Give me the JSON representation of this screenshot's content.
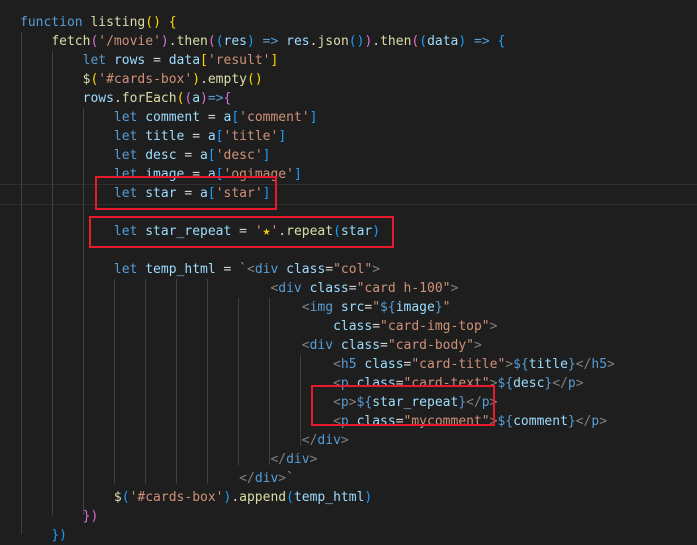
{
  "editor": {
    "lines": [
      [
        [
          "kw",
          "function"
        ],
        [
          "op",
          " "
        ],
        [
          "fn",
          "listing"
        ],
        [
          "b1",
          "()"
        ],
        [
          "op",
          " "
        ],
        [
          "b1",
          "{"
        ]
      ],
      [
        [
          "op",
          "    "
        ],
        [
          "fn",
          "fetch"
        ],
        [
          "b2",
          "("
        ],
        [
          "str",
          "'/movie'"
        ],
        [
          "b2",
          ")"
        ],
        [
          "op",
          "."
        ],
        [
          "fn",
          "then"
        ],
        [
          "b2",
          "("
        ],
        [
          "b3",
          "("
        ],
        [
          "var",
          "res"
        ],
        [
          "b3",
          ")"
        ],
        [
          "op",
          " "
        ],
        [
          "kw",
          "=>"
        ],
        [
          "op",
          " "
        ],
        [
          "var",
          "res"
        ],
        [
          "op",
          "."
        ],
        [
          "fn",
          "json"
        ],
        [
          "b3",
          "()"
        ],
        [
          "b2",
          ")"
        ],
        [
          "op",
          "."
        ],
        [
          "fn",
          "then"
        ],
        [
          "b2",
          "("
        ],
        [
          "b3",
          "("
        ],
        [
          "var",
          "data"
        ],
        [
          "b3",
          ")"
        ],
        [
          "op",
          " "
        ],
        [
          "kw",
          "=>"
        ],
        [
          "op",
          " "
        ],
        [
          "b3",
          "{"
        ]
      ],
      [
        [
          "op",
          "        "
        ],
        [
          "kw",
          "let"
        ],
        [
          "op",
          " "
        ],
        [
          "var",
          "rows"
        ],
        [
          "op",
          " = "
        ],
        [
          "var",
          "data"
        ],
        [
          "b1",
          "["
        ],
        [
          "str",
          "'result'"
        ],
        [
          "b1",
          "]"
        ]
      ],
      [
        [
          "op",
          "        "
        ],
        [
          "fn",
          "$"
        ],
        [
          "b1",
          "("
        ],
        [
          "str",
          "'#cards-box'"
        ],
        [
          "b1",
          ")"
        ],
        [
          "op",
          "."
        ],
        [
          "fn",
          "empty"
        ],
        [
          "b1",
          "()"
        ]
      ],
      [
        [
          "op",
          "        "
        ],
        [
          "var",
          "rows"
        ],
        [
          "op",
          "."
        ],
        [
          "fn",
          "forEach"
        ],
        [
          "b1",
          "("
        ],
        [
          "b2",
          "("
        ],
        [
          "var",
          "a"
        ],
        [
          "b2",
          ")"
        ],
        [
          "kw",
          "=>"
        ],
        [
          "b2",
          "{"
        ]
      ],
      [
        [
          "op",
          "            "
        ],
        [
          "kw",
          "let"
        ],
        [
          "op",
          " "
        ],
        [
          "var",
          "comment"
        ],
        [
          "op",
          " = "
        ],
        [
          "var",
          "a"
        ],
        [
          "b3",
          "["
        ],
        [
          "str",
          "'comment'"
        ],
        [
          "b3",
          "]"
        ]
      ],
      [
        [
          "op",
          "            "
        ],
        [
          "kw",
          "let"
        ],
        [
          "op",
          " "
        ],
        [
          "var",
          "title"
        ],
        [
          "op",
          " = "
        ],
        [
          "var",
          "a"
        ],
        [
          "b3",
          "["
        ],
        [
          "str",
          "'title'"
        ],
        [
          "b3",
          "]"
        ]
      ],
      [
        [
          "op",
          "            "
        ],
        [
          "kw",
          "let"
        ],
        [
          "op",
          " "
        ],
        [
          "var",
          "desc"
        ],
        [
          "op",
          " = "
        ],
        [
          "var",
          "a"
        ],
        [
          "b3",
          "["
        ],
        [
          "str",
          "'desc'"
        ],
        [
          "b3",
          "]"
        ]
      ],
      [
        [
          "op",
          "            "
        ],
        [
          "kw",
          "let"
        ],
        [
          "op",
          " "
        ],
        [
          "var",
          "image"
        ],
        [
          "op",
          " = "
        ],
        [
          "var",
          "a"
        ],
        [
          "b3",
          "["
        ],
        [
          "str",
          "'ogimage'"
        ],
        [
          "b3",
          "]"
        ]
      ],
      [
        [
          "op",
          "            "
        ],
        [
          "kw",
          "let"
        ],
        [
          "op",
          " "
        ],
        [
          "var",
          "star"
        ],
        [
          "op",
          " = "
        ],
        [
          "var",
          "a"
        ],
        [
          "b3",
          "["
        ],
        [
          "str",
          "'star'"
        ],
        [
          "b3",
          "]"
        ]
      ],
      [],
      [
        [
          "op",
          "            "
        ],
        [
          "kw",
          "let"
        ],
        [
          "op",
          " "
        ],
        [
          "var",
          "star_repeat"
        ],
        [
          "op",
          " = "
        ],
        [
          "str",
          "'"
        ],
        [
          "star",
          "★"
        ],
        [
          "str",
          "'"
        ],
        [
          "op",
          "."
        ],
        [
          "fn",
          "repeat"
        ],
        [
          "b3",
          "("
        ],
        [
          "var",
          "star"
        ],
        [
          "b3",
          ")"
        ]
      ],
      [],
      [
        [
          "op",
          "            "
        ],
        [
          "kw",
          "let"
        ],
        [
          "op",
          " "
        ],
        [
          "var",
          "temp_html"
        ],
        [
          "op",
          " = "
        ],
        [
          "str",
          "`"
        ],
        [
          "tag",
          "<"
        ],
        [
          "tn",
          "div"
        ],
        [
          "op",
          " "
        ],
        [
          "attr",
          "class"
        ],
        [
          "op",
          "="
        ],
        [
          "aval",
          "\"col\""
        ],
        [
          "tag",
          ">"
        ]
      ],
      [
        [
          "op",
          "                                "
        ],
        [
          "tag",
          "<"
        ],
        [
          "tn",
          "div"
        ],
        [
          "op",
          " "
        ],
        [
          "attr",
          "class"
        ],
        [
          "op",
          "="
        ],
        [
          "aval",
          "\"card h-100\""
        ],
        [
          "tag",
          ">"
        ]
      ],
      [
        [
          "op",
          "                                    "
        ],
        [
          "tag",
          "<"
        ],
        [
          "tn",
          "img"
        ],
        [
          "op",
          " "
        ],
        [
          "attr",
          "src"
        ],
        [
          "op",
          "="
        ],
        [
          "aval",
          "\""
        ],
        [
          "tmpl",
          "${"
        ],
        [
          "var",
          "image"
        ],
        [
          "tmpl",
          "}"
        ],
        [
          "aval",
          "\""
        ]
      ],
      [
        [
          "op",
          "                                        "
        ],
        [
          "attr",
          "class"
        ],
        [
          "op",
          "="
        ],
        [
          "aval",
          "\"card-img-top\""
        ],
        [
          "tag",
          ">"
        ]
      ],
      [
        [
          "op",
          "                                    "
        ],
        [
          "tag",
          "<"
        ],
        [
          "tn",
          "div"
        ],
        [
          "op",
          " "
        ],
        [
          "attr",
          "class"
        ],
        [
          "op",
          "="
        ],
        [
          "aval",
          "\"card-body\""
        ],
        [
          "tag",
          ">"
        ]
      ],
      [
        [
          "op",
          "                                        "
        ],
        [
          "tag",
          "<"
        ],
        [
          "tn",
          "h5"
        ],
        [
          "op",
          " "
        ],
        [
          "attr",
          "class"
        ],
        [
          "op",
          "="
        ],
        [
          "aval",
          "\"card-title\""
        ],
        [
          "tag",
          ">"
        ],
        [
          "tmpl",
          "${"
        ],
        [
          "var",
          "title"
        ],
        [
          "tmpl",
          "}"
        ],
        [
          "tag",
          "</"
        ],
        [
          "tn",
          "h5"
        ],
        [
          "tag",
          ">"
        ]
      ],
      [
        [
          "op",
          "                                        "
        ],
        [
          "tag",
          "<"
        ],
        [
          "tn",
          "p"
        ],
        [
          "op",
          " "
        ],
        [
          "attr",
          "class"
        ],
        [
          "op",
          "="
        ],
        [
          "aval",
          "\"card-text\""
        ],
        [
          "tag",
          ">"
        ],
        [
          "tmpl",
          "${"
        ],
        [
          "var",
          "desc"
        ],
        [
          "tmpl",
          "}"
        ],
        [
          "tag",
          "</"
        ],
        [
          "tn",
          "p"
        ],
        [
          "tag",
          ">"
        ]
      ],
      [
        [
          "op",
          "                                        "
        ],
        [
          "tag",
          "<"
        ],
        [
          "tn",
          "p"
        ],
        [
          "tag",
          ">"
        ],
        [
          "tmpl",
          "${"
        ],
        [
          "var",
          "star_repeat"
        ],
        [
          "tmpl",
          "}"
        ],
        [
          "tag",
          "</"
        ],
        [
          "tn",
          "p"
        ],
        [
          "tag",
          ">"
        ]
      ],
      [
        [
          "op",
          "                                        "
        ],
        [
          "tag",
          "<"
        ],
        [
          "tn",
          "p"
        ],
        [
          "op",
          " "
        ],
        [
          "attr",
          "class"
        ],
        [
          "op",
          "="
        ],
        [
          "aval",
          "\"mycomment\""
        ],
        [
          "tag",
          ">"
        ],
        [
          "tmpl",
          "${"
        ],
        [
          "var",
          "comment"
        ],
        [
          "tmpl",
          "}"
        ],
        [
          "tag",
          "</"
        ],
        [
          "tn",
          "p"
        ],
        [
          "tag",
          ">"
        ]
      ],
      [
        [
          "op",
          "                                    "
        ],
        [
          "tag",
          "</"
        ],
        [
          "tn",
          "div"
        ],
        [
          "tag",
          ">"
        ]
      ],
      [
        [
          "op",
          "                                "
        ],
        [
          "tag",
          "</"
        ],
        [
          "tn",
          "div"
        ],
        [
          "tag",
          ">"
        ]
      ],
      [
        [
          "op",
          "                            "
        ],
        [
          "tag",
          "</"
        ],
        [
          "tn",
          "div"
        ],
        [
          "tag",
          ">"
        ],
        [
          "str",
          "`"
        ]
      ],
      [
        [
          "op",
          "            "
        ],
        [
          "fn",
          "$"
        ],
        [
          "b3",
          "("
        ],
        [
          "str",
          "'#cards-box'"
        ],
        [
          "b3",
          ")"
        ],
        [
          "op",
          "."
        ],
        [
          "fn",
          "append"
        ],
        [
          "b3",
          "("
        ],
        [
          "var",
          "temp_html"
        ],
        [
          "b3",
          ")"
        ]
      ],
      [
        [
          "op",
          "        "
        ],
        [
          "b2",
          "})"
        ]
      ],
      [
        [
          "op",
          "    "
        ],
        [
          "b3",
          "})"
        ]
      ]
    ]
  },
  "colors": {
    "background": "#1e1e1e",
    "highlight_box": "#e8192c",
    "star": "#f5c518"
  }
}
